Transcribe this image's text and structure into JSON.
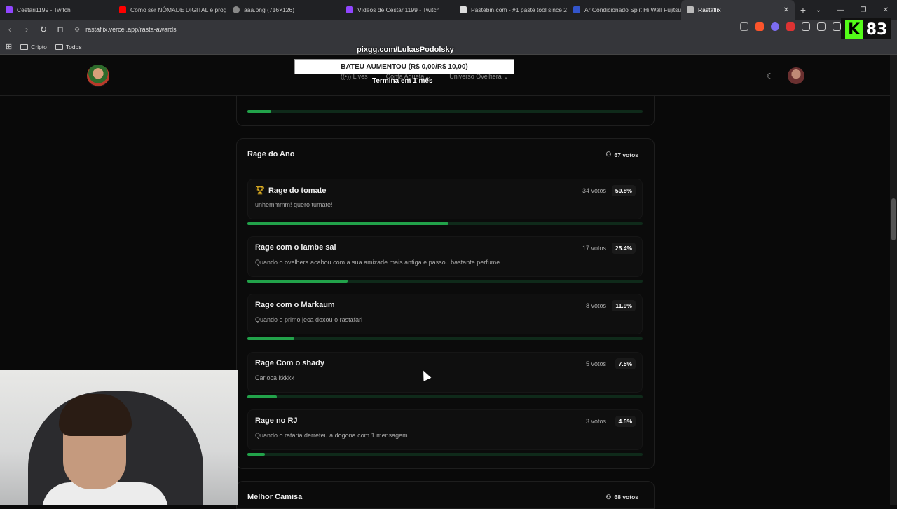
{
  "browser": {
    "tabs": [
      {
        "title": "Cestari1199 - Twitch",
        "color": "#9146ff"
      },
      {
        "title": "Como ser NÔMADE DIGITAL e prog",
        "color": "#ff0000"
      },
      {
        "title": "aaa.png (716×126)",
        "color": "#888888"
      },
      {
        "title": "Vídeos de Cestari1199 - Twitch",
        "color": "#9146ff"
      },
      {
        "title": "Pastebin.com - #1 paste tool since 2",
        "color": "#dddddd"
      },
      {
        "title": "Ar Condicionado Split Hi Wall Fujitsu",
        "color": "#3355cc"
      },
      {
        "title": "Rastaflix",
        "color": "#ffffff"
      }
    ],
    "url": "rastaflix.vercel.app/rasta-awards",
    "bookmarks": [
      "Cripto",
      "Todos"
    ]
  },
  "overlay": {
    "pix": "pixgg.com/LukasPodolsky",
    "goal": "BATEU AUMENTOU (R$ 0,00/R$ 10,00)",
    "goal_sub": "Termina em 1 mês",
    "kick_count": "83"
  },
  "site": {
    "nav": [
      "Lives",
      "Conta Aqueta",
      "Universo Ovelhera"
    ]
  },
  "prev_card": {
    "progress_pct": 6
  },
  "category": {
    "title": "Rage do Ano",
    "total_votes": "67 votos",
    "entries": [
      {
        "name": "Rage do tomate",
        "desc": "unhemmmm! quero tumate!",
        "votes": "34 votos",
        "pct": "50.8%",
        "pct_value": 50.8,
        "winner": true
      },
      {
        "name": "Rage com o lambe sal",
        "desc": "Quando o ovelhera acabou com a sua amizade mais antiga e passou bastante perfume",
        "votes": "17 votos",
        "pct": "25.4%",
        "pct_value": 25.4,
        "winner": false
      },
      {
        "name": "Rage com o Markaum",
        "desc": "Quando o primo jeca doxou o rastafari",
        "votes": "8 votos",
        "pct": "11.9%",
        "pct_value": 11.9,
        "winner": false
      },
      {
        "name": "Rage Com o shady",
        "desc": "Carioca kkkkk",
        "votes": "5 votos",
        "pct": "7.5%",
        "pct_value": 7.5,
        "winner": false
      },
      {
        "name": "Rage no RJ",
        "desc": "Quando o rataria derreteu a dogona com 1 mensagem",
        "votes": "3 votos",
        "pct": "4.5%",
        "pct_value": 4.5,
        "winner": false
      }
    ]
  },
  "next_category": {
    "title": "Melhor Camisa",
    "total_votes": "68 votos"
  }
}
